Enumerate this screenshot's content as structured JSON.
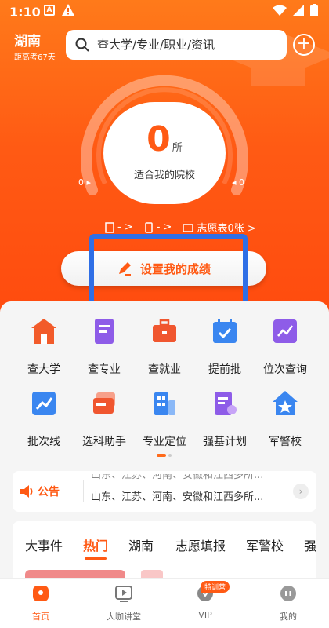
{
  "status": {
    "time": "1:10"
  },
  "header": {
    "province": "湖南",
    "countdown": "距高考67天",
    "search_placeholder": "查大学/专业/职业/资讯"
  },
  "gauge": {
    "count": "0",
    "unit": "所",
    "label": "适合我的院校",
    "left_value": "0",
    "right_value": "0"
  },
  "quick_links": [
    {
      "label": "- >",
      "icon": "document-icon"
    },
    {
      "label": "- >",
      "icon": "phone-icon"
    },
    {
      "label": "志愿表0张 >",
      "icon": "folder-icon"
    }
  ],
  "score_button": {
    "label": "设置我的成绩"
  },
  "grid": [
    {
      "label": "查大学",
      "icon": "school-icon",
      "color": "#f25b2a"
    },
    {
      "label": "查专业",
      "icon": "book-icon",
      "color": "#8e5ce8"
    },
    {
      "label": "查就业",
      "icon": "briefcase-icon",
      "color": "#f0562f"
    },
    {
      "label": "提前批",
      "icon": "calendar-check-icon",
      "color": "#3a86f0"
    },
    {
      "label": "位次查询",
      "icon": "chart-icon",
      "color": "#8e5ce8"
    },
    {
      "label": "批次线",
      "icon": "trend-icon",
      "color": "#3a86f0"
    },
    {
      "label": "选科助手",
      "icon": "cards-icon",
      "color": "#f0562f"
    },
    {
      "label": "专业定位",
      "icon": "building-icon",
      "color": "#3a86f0"
    },
    {
      "label": "强基计划",
      "icon": "doc-badge-icon",
      "color": "#8e5ce8"
    },
    {
      "label": "军警校",
      "icon": "star-house-icon",
      "color": "#3a86f0"
    }
  ],
  "notice": {
    "tag": "公告",
    "text_top": "山东、江苏、河南、安徽和江西多所...",
    "text": "山东、江苏、河南、安徽和江西多所..."
  },
  "tabs": [
    "大事件",
    "热门",
    "湖南",
    "志愿填报",
    "军警校",
    "强"
  ],
  "active_tab": "热门",
  "bottom_nav": [
    {
      "label": "首页",
      "icon": "home-icon",
      "active": true
    },
    {
      "label": "大咖讲堂",
      "icon": "video-icon",
      "active": false
    },
    {
      "label": "VIP",
      "icon": "vip-icon",
      "active": false
    },
    {
      "label": "我的",
      "icon": "profile-icon",
      "active": false
    }
  ],
  "vip_badge": "特训营",
  "colors": {
    "primary": "#ff5a14",
    "highlight_box": "#2f6fe6"
  }
}
